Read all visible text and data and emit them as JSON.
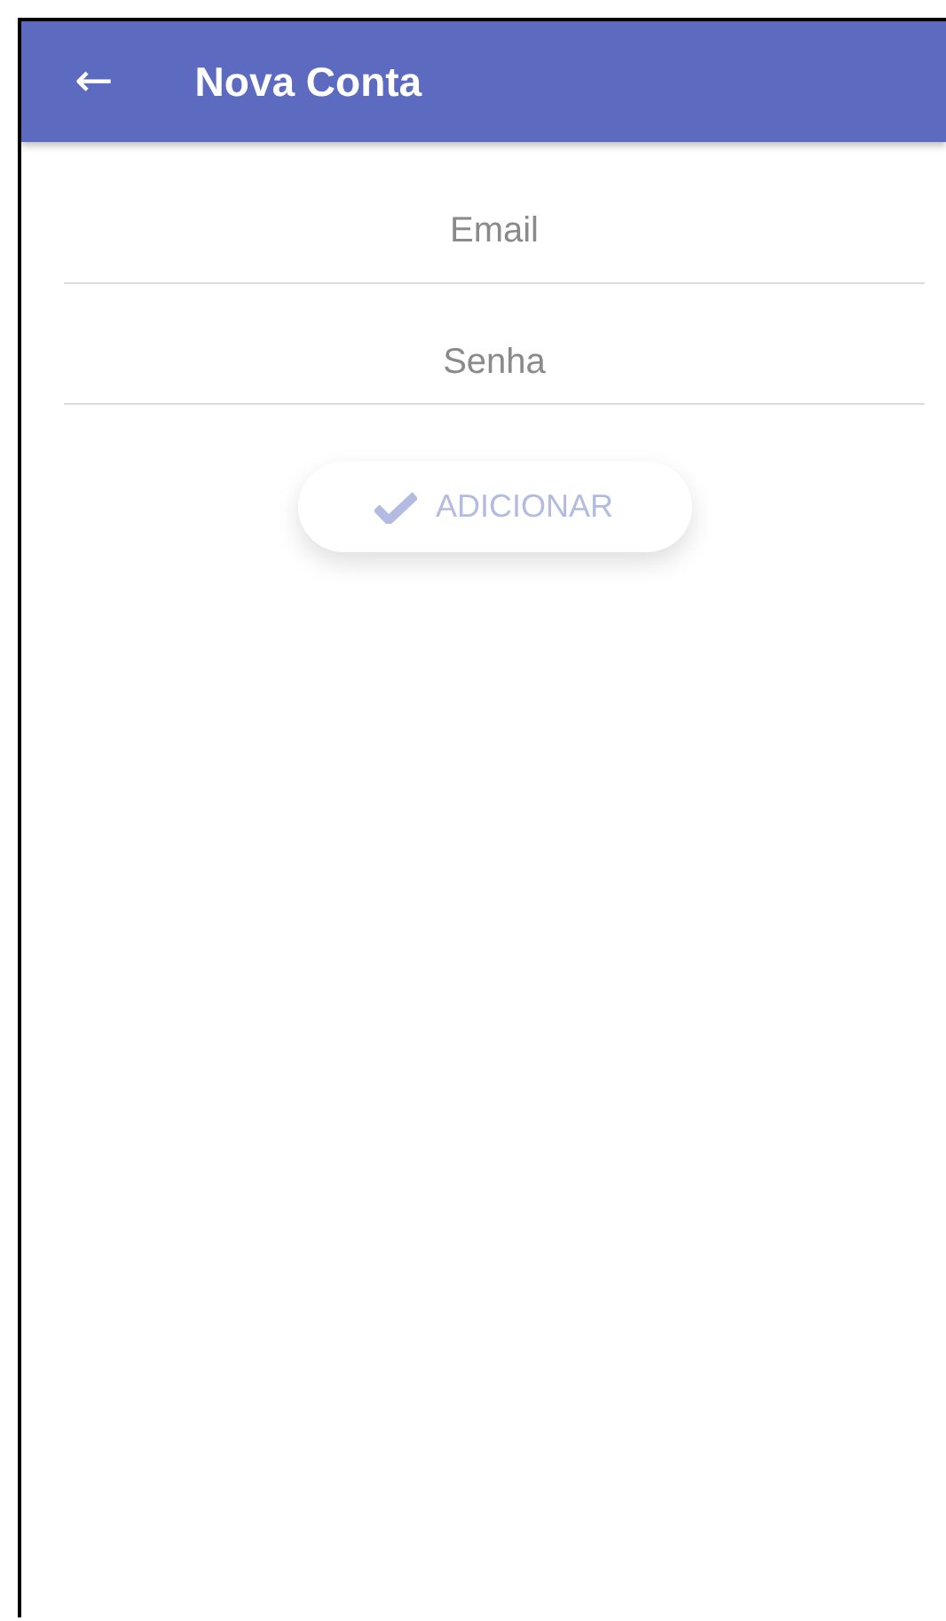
{
  "header": {
    "back_icon": "←",
    "title": "Nova Conta"
  },
  "fields": [
    {
      "placeholder": "Email"
    },
    {
      "placeholder": "Senha"
    }
  ],
  "submit_button": {
    "label": "ADICIONAR",
    "disabled": true
  }
}
